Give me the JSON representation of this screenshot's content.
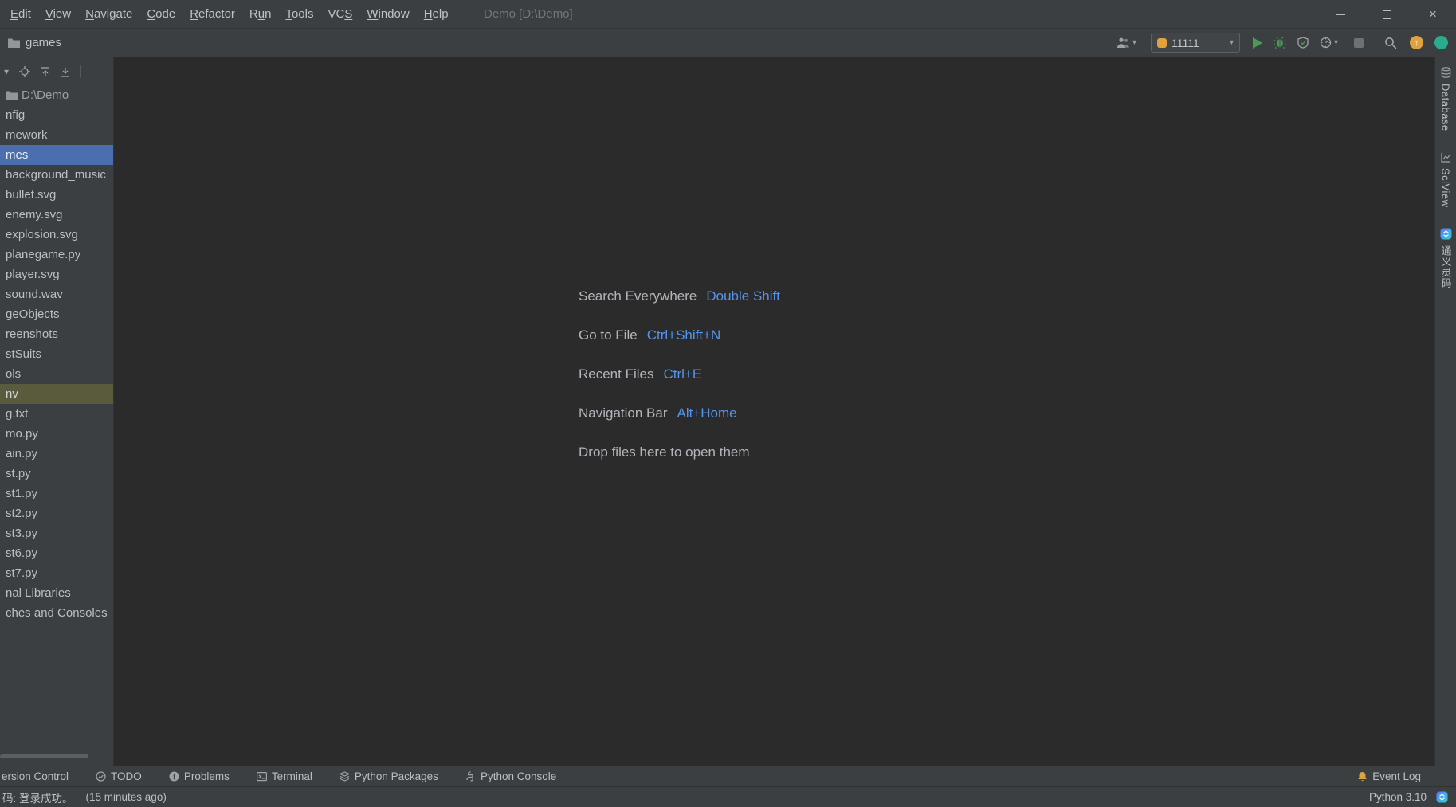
{
  "window": {
    "title": "Demo [D:\\Demo]"
  },
  "menu": {
    "items": [
      {
        "label": "Edit",
        "mnemonic": 0
      },
      {
        "label": "View",
        "mnemonic": 0
      },
      {
        "label": "Navigate",
        "mnemonic": 0
      },
      {
        "label": "Code",
        "mnemonic": 0
      },
      {
        "label": "Refactor",
        "mnemonic": 0
      },
      {
        "label": "Run",
        "mnemonic": 1
      },
      {
        "label": "Tools",
        "mnemonic": 0
      },
      {
        "label": "VCS",
        "mnemonic": 2
      },
      {
        "label": "Window",
        "mnemonic": 0
      },
      {
        "label": "Help",
        "mnemonic": 0
      }
    ]
  },
  "toolbar": {
    "breadcrumb": "games",
    "run_config": "11111"
  },
  "project_panel": {
    "tree": [
      {
        "label": "D:\\Demo",
        "variant": "root"
      },
      {
        "label": "nfig"
      },
      {
        "label": "mework"
      },
      {
        "label": "mes",
        "variant": "selected"
      },
      {
        "label": "background_music"
      },
      {
        "label": "bullet.svg"
      },
      {
        "label": "enemy.svg"
      },
      {
        "label": "explosion.svg"
      },
      {
        "label": "planegame.py"
      },
      {
        "label": "player.svg"
      },
      {
        "label": "sound.wav"
      },
      {
        "label": "geObjects"
      },
      {
        "label": "reenshots"
      },
      {
        "label": "stSuits"
      },
      {
        "label": "ols"
      },
      {
        "label": "nv",
        "variant": "olive"
      },
      {
        "label": "g.txt"
      },
      {
        "label": "mo.py"
      },
      {
        "label": "ain.py"
      },
      {
        "label": "st.py"
      },
      {
        "label": "st1.py"
      },
      {
        "label": "st2.py"
      },
      {
        "label": "st3.py"
      },
      {
        "label": "st6.py"
      },
      {
        "label": "st7.py"
      },
      {
        "label": "nal Libraries"
      },
      {
        "label": "ches and Consoles"
      }
    ]
  },
  "editor_hints": {
    "lines": [
      {
        "label": "Search Everywhere",
        "shortcut": "Double Shift"
      },
      {
        "label": "Go to File",
        "shortcut": "Ctrl+Shift+N"
      },
      {
        "label": "Recent Files",
        "shortcut": "Ctrl+E"
      },
      {
        "label": "Navigation Bar",
        "shortcut": "Alt+Home"
      },
      {
        "label": "Drop files here to open them",
        "shortcut": ""
      }
    ]
  },
  "right_stripe": {
    "tabs": [
      {
        "label": "Database",
        "icon": "database"
      },
      {
        "label": "SciView",
        "icon": "sciview"
      },
      {
        "label": "通义灵码",
        "icon": "tongyi"
      }
    ]
  },
  "bottom_toolbar": {
    "left": [
      {
        "label": "ersion Control",
        "icon": ""
      },
      {
        "label": "TODO",
        "icon": "todo"
      },
      {
        "label": "Problems",
        "icon": "problems"
      },
      {
        "label": "Terminal",
        "icon": "terminal"
      },
      {
        "label": "Python Packages",
        "icon": "packages"
      },
      {
        "label": "Python Console",
        "icon": "pyconsole"
      }
    ],
    "right": [
      {
        "label": "Event Log",
        "icon": "eventlog"
      }
    ]
  },
  "statusbar": {
    "message": "码: 登录成功。",
    "time": "(15 minutes ago)",
    "python_version": "Python 3.10"
  },
  "icons": {
    "caret_down": "▾",
    "up_arrow": "↑",
    "close": "×"
  },
  "colors": {
    "accent_blue": "#5394ec",
    "selection_blue": "#4b6eaf",
    "selection_olive": "#5a5a3c",
    "run_green": "#499c54",
    "update_orange": "#e0a23c",
    "teal": "#2aab8e"
  }
}
